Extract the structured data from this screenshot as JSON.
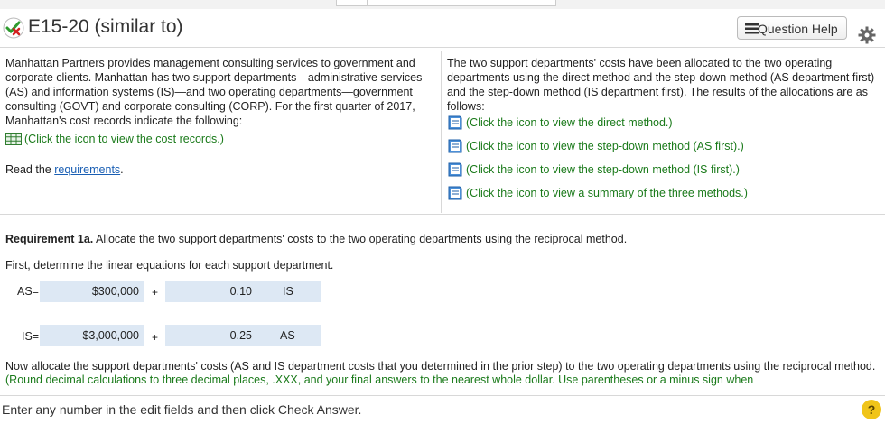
{
  "header": {
    "title": "E15-20 (similar to)",
    "help_label": "Question Help"
  },
  "left": {
    "intro": "Manhattan Partners provides management consulting services to government and corporate clients. Manhattan has two support departments—administrative services (AS) and information systems (IS)—and two operating departments—government consulting (GOVT) and corporate consulting (CORP). For the first quarter of 2017, Manhattan's cost records indicate the following:",
    "cost_records_link": "(Click the icon to view the cost records.)",
    "read_prefix": "Read the ",
    "requirements_link": "requirements",
    "read_suffix": "."
  },
  "right": {
    "intro": "The two support departments' costs have been allocated to the two operating departments using the direct method and the step-down method (AS department first) and the step-down method (IS department first). The results of the allocations are as follows:",
    "links": [
      "(Click the icon to view the direct method.)",
      "(Click the icon to view the step-down method (AS first).)",
      "(Click the icon to view the step-down method (IS first).)",
      "(Click the icon to view a summary of the three methods.)"
    ]
  },
  "question": {
    "req_label": "Requirement 1a.",
    "req_text": " Allocate the two support departments' costs to the two operating departments using the reciprocal method.",
    "first_line": "First, determine the linear equations for each support department.",
    "as_eq": {
      "label": "AS=",
      "amount": "$300,000",
      "plus": "+",
      "coef": "0.10",
      "var": "IS"
    },
    "is_eq": {
      "label": "IS=",
      "amount": "$3,000,000",
      "plus": "+",
      "coef": "0.25",
      "var": "AS"
    },
    "now_text": "Now allocate the support departments' costs (AS and IS department costs that you determined in the prior step) to the two operating departments using the reciprocal method. ",
    "now_green": "(Round decimal calculations to three decimal places, .XXX, and your final answers to the nearest whole dollar. Use parentheses or a minus sign when"
  },
  "footer": {
    "instruction": "Enter any number in the edit fields and then click Check Answer.",
    "help_glyph": "?"
  },
  "colors": {
    "link_green": "#1a7a1a",
    "link_blue": "#1a5fb4",
    "field_bg": "#dde8f4",
    "help_yellow": "#f0c419"
  }
}
